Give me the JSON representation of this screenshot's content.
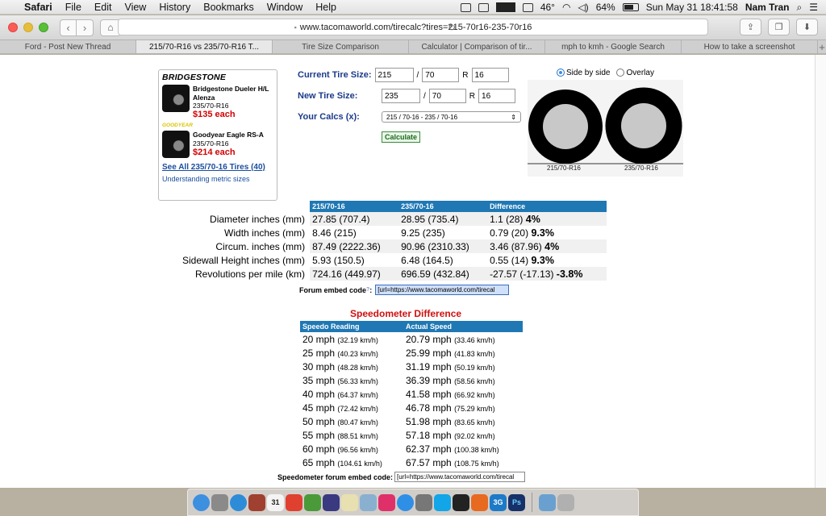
{
  "menubar": {
    "app": "Safari",
    "menus": [
      "File",
      "Edit",
      "View",
      "History",
      "Bookmarks",
      "Window",
      "Help"
    ],
    "temperature": "46°",
    "battery": "64%",
    "datetime": "Sun May 31  18:41:58",
    "user": "Nam Tran"
  },
  "toolbar": {
    "url": "www.tacomaworld.com/tirecalc?tires=215-70r16-235-70r16"
  },
  "tabs": [
    "Ford - Post New Thread",
    "215/70-R16 vs 235/70-R16 T...",
    "Tire Size Comparison",
    "Calculator | Comparison of tir...",
    "mph to kmh - Google Search",
    "How to take a screenshot"
  ],
  "ad": {
    "brand1": "BRIDGESTONE",
    "product1_name": "Bridgestone Dueler H/L Alenza",
    "product1_size": "235/70-R16",
    "product1_price": "$135 each",
    "brand2": "GOODYEAR",
    "product2_name": "Goodyear Eagle RS-A",
    "product2_size": "235/70-R16",
    "product2_price": "$214 each",
    "see_all": "See All 235/70-16 Tires (40)",
    "understanding": "Understanding metric sizes"
  },
  "form": {
    "current_label": "Current Tire Size:",
    "current_width": "215",
    "current_ratio": "70",
    "current_rim": "16",
    "new_label": "New Tire Size:",
    "new_width": "235",
    "new_ratio": "70",
    "new_rim": "16",
    "slash": "/",
    "r": "R",
    "calcs_label": "Your Calcs (x):",
    "calcs_value": "215 / 70-16 - 235 / 70-16",
    "calculate": "Calculate"
  },
  "view": {
    "side_by_side": "Side by side",
    "overlay": "Overlay",
    "left_label": "215/70-R16",
    "right_label": "235/70-R16"
  },
  "comparison": {
    "headers": [
      "215/70-16",
      "235/70-16",
      "Difference"
    ],
    "rows": [
      {
        "label": "Diameter inches (mm)",
        "a": "27.85 (707.4)",
        "b": "28.95 (735.4)",
        "diff": "1.1 (28)",
        "pct": "4%"
      },
      {
        "label": "Width inches (mm)",
        "a": "8.46 (215)",
        "b": "9.25 (235)",
        "diff": "0.79 (20)",
        "pct": "9.3%"
      },
      {
        "label": "Circum. inches (mm)",
        "a": "87.49 (2222.36)",
        "b": "90.96 (2310.33)",
        "diff": "3.46 (87.96)",
        "pct": "4%"
      },
      {
        "label": "Sidewall Height inches (mm)",
        "a": "5.93 (150.5)",
        "b": "6.48 (164.5)",
        "diff": "0.55 (14)",
        "pct": "9.3%"
      },
      {
        "label": "Revolutions per mile (km)",
        "a": "724.16 (449.97)",
        "b": "696.59 (432.84)",
        "diff": "-27.57 (-17.13)",
        "pct": "-3.8%"
      }
    ]
  },
  "embed1": {
    "label": "Forum embed code",
    "q": "?",
    "colon": ":",
    "value": "[url=https://www.tacomaworld.com/tirecal"
  },
  "speedo": {
    "title": "Speedometer Difference",
    "headers": [
      "Speedo Reading",
      "Actual Speed"
    ],
    "rows": [
      {
        "r": "20 mph",
        "rk": "(32.19 km/h)",
        "a": "20.79 mph",
        "ak": "(33.46 km/h)"
      },
      {
        "r": "25 mph",
        "rk": "(40.23 km/h)",
        "a": "25.99 mph",
        "ak": "(41.83 km/h)"
      },
      {
        "r": "30 mph",
        "rk": "(48.28 km/h)",
        "a": "31.19 mph",
        "ak": "(50.19 km/h)"
      },
      {
        "r": "35 mph",
        "rk": "(56.33 km/h)",
        "a": "36.39 mph",
        "ak": "(58.56 km/h)"
      },
      {
        "r": "40 mph",
        "rk": "(64.37 km/h)",
        "a": "41.58 mph",
        "ak": "(66.92 km/h)"
      },
      {
        "r": "45 mph",
        "rk": "(72.42 km/h)",
        "a": "46.78 mph",
        "ak": "(75.29 km/h)"
      },
      {
        "r": "50 mph",
        "rk": "(80.47 km/h)",
        "a": "51.98 mph",
        "ak": "(83.65 km/h)"
      },
      {
        "r": "55 mph",
        "rk": "(88.51 km/h)",
        "a": "57.18 mph",
        "ak": "(92.02 km/h)"
      },
      {
        "r": "60 mph",
        "rk": "(96.56 km/h)",
        "a": "62.37 mph",
        "ak": "(100.38 km/h)"
      },
      {
        "r": "65 mph",
        "rk": "(104.61 km/h)",
        "a": "67.57 mph",
        "ak": "(108.75 km/h)"
      }
    ]
  },
  "embed2": {
    "label": "Speedometer forum embed code:",
    "value": "[url=https://www.tacomaworld.com/tirecal"
  },
  "dock": {
    "icons": [
      {
        "name": "finder-icon",
        "color": "#3d8fe0"
      },
      {
        "name": "launchpad-icon",
        "color": "#8a8a8a"
      },
      {
        "name": "safari-icon",
        "color": "#2d8cd8"
      },
      {
        "name": "dictionary-icon",
        "color": "#a04030"
      },
      {
        "name": "calendar-icon",
        "color": "#f4f4f4"
      },
      {
        "name": "chrome-icon",
        "color": "#e04030"
      },
      {
        "name": "evernote-icon",
        "color": "#4a9a3a"
      },
      {
        "name": "eclipse-icon",
        "color": "#3a3a80"
      },
      {
        "name": "notes-icon",
        "color": "#e8e0b0"
      },
      {
        "name": "preview-icon",
        "color": "#8ab0d0"
      },
      {
        "name": "itunes-icon",
        "color": "#e0306a"
      },
      {
        "name": "appstore-icon",
        "color": "#2f8fe6"
      },
      {
        "name": "preferences-icon",
        "color": "#777777"
      },
      {
        "name": "skype-icon",
        "color": "#12a5e8"
      },
      {
        "name": "terminal-icon",
        "color": "#222222"
      },
      {
        "name": "firefox-icon",
        "color": "#e86a20"
      },
      {
        "name": "3g-icon",
        "color": "#1d7ac8"
      },
      {
        "name": "photoshop-icon",
        "color": "#16306a"
      },
      {
        "name": "downloads-icon",
        "color": "#6aa0d0"
      },
      {
        "name": "trash-icon",
        "color": "#b0b0b0"
      }
    ],
    "calendar_day": "31",
    "ps_text": "Ps",
    "threeg_text": "3G"
  }
}
